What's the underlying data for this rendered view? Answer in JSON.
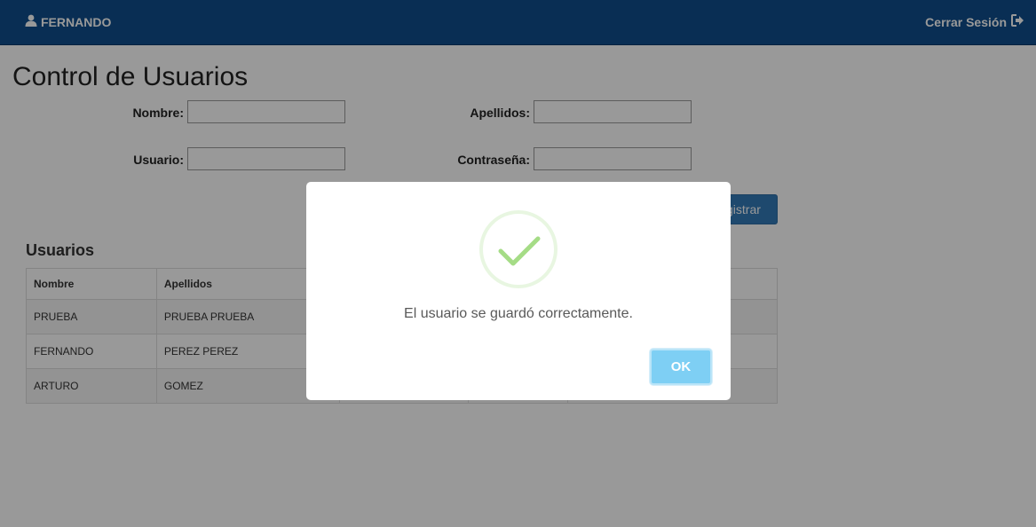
{
  "navbar": {
    "user_name": "FERNANDO",
    "logout_label": "Cerrar Sesión"
  },
  "page": {
    "title": "Control de Usuarios"
  },
  "form": {
    "nombre_label": "Nombre:",
    "nombre_value": "",
    "apellidos_label": "Apellidos:",
    "apellidos_value": "",
    "usuario_label": "Usuario:",
    "usuario_value": "",
    "contrasena_label": "Contraseña:",
    "contrasena_value": "",
    "registrar_label": "Registrar"
  },
  "users_section": {
    "title": "Usuarios",
    "columns": [
      "Nombre",
      "Apellidos",
      "",
      "",
      ""
    ],
    "rows": [
      [
        "PRUEBA",
        "PRUEBA PRUEBA"
      ],
      [
        "FERNANDO",
        "PEREZ PEREZ"
      ],
      [
        "ARTURO",
        "GOMEZ"
      ]
    ]
  },
  "modal": {
    "icon": "success-check-icon",
    "message": "El usuario se guardó correctamente.",
    "ok_label": "OK",
    "accent_color": "#a5dc86",
    "ok_color": "#7ecff4"
  }
}
